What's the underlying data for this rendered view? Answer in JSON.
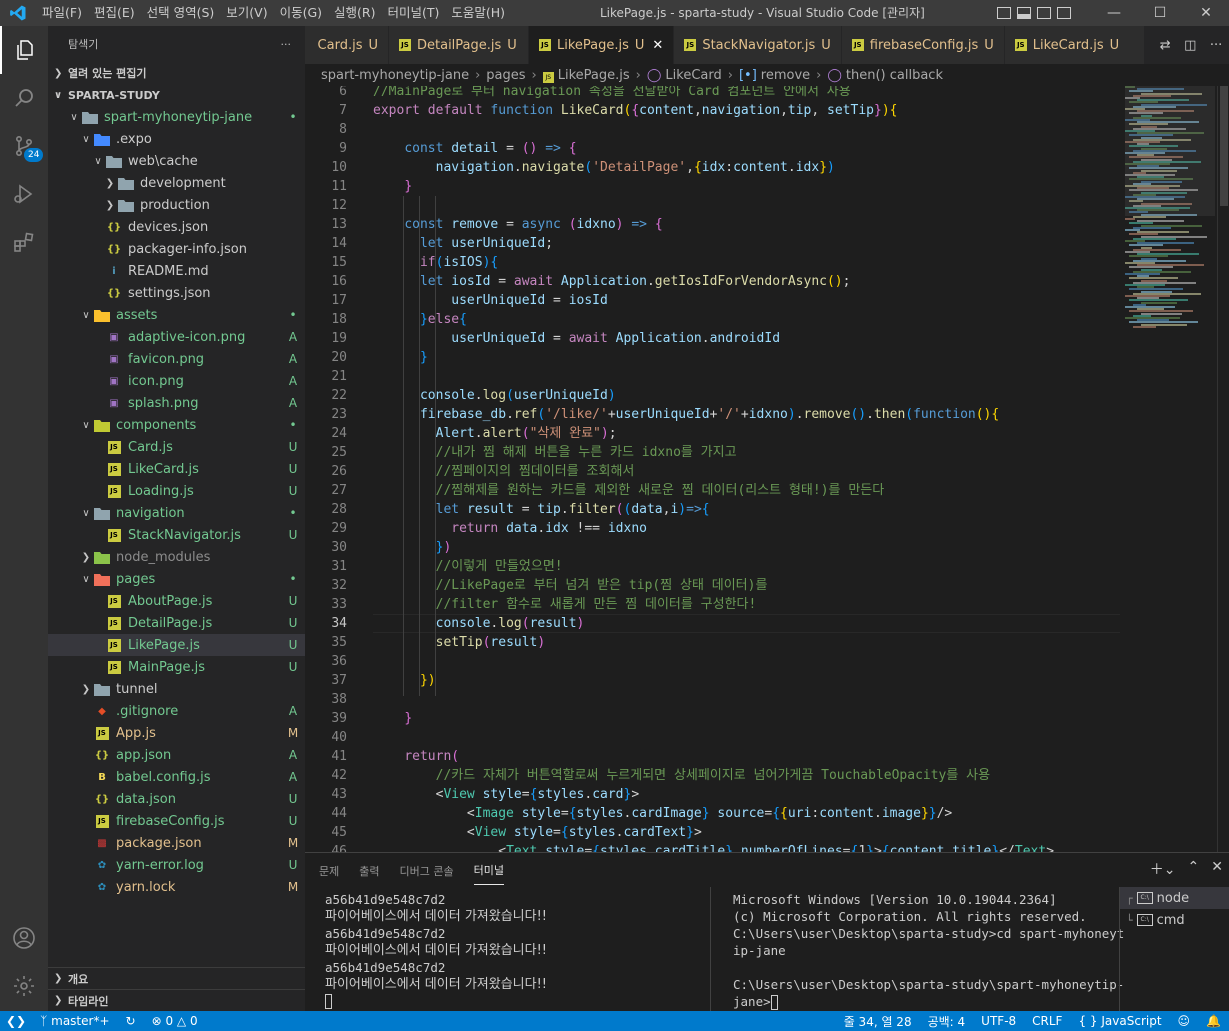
{
  "titlebar": {
    "menu": [
      "파일(F)",
      "편집(E)",
      "선택 영역(S)",
      "보기(V)",
      "이동(G)",
      "실행(R)",
      "터미널(T)",
      "도움말(H)"
    ],
    "title": "LikePage.js - sparta-study - Visual Studio Code [관리자]"
  },
  "activity": {
    "badge": "24"
  },
  "sidebar": {
    "header": "탐색기",
    "open_editors": "열려 있는 편집기",
    "root": "SPARTA-STUDY",
    "tree": [
      {
        "label": "spart-myhoneytip-jane",
        "depth": 1,
        "kind": "folder-open",
        "status": "•",
        "color": "#73c991"
      },
      {
        "label": ".expo",
        "depth": 2,
        "kind": "folder-open",
        "status": "",
        "color": "#cccccc"
      },
      {
        "label": "web\\cache",
        "depth": 3,
        "kind": "folder-open",
        "status": "",
        "color": "#cccccc"
      },
      {
        "label": "development",
        "depth": 4,
        "kind": "folder",
        "status": "",
        "color": "#cccccc"
      },
      {
        "label": "production",
        "depth": 4,
        "kind": "folder",
        "status": "",
        "color": "#cccccc"
      },
      {
        "label": "devices.json",
        "depth": 3,
        "kind": "json",
        "status": "",
        "color": "#cccccc"
      },
      {
        "label": "packager-info.json",
        "depth": 3,
        "kind": "json",
        "status": "",
        "color": "#cccccc"
      },
      {
        "label": "README.md",
        "depth": 3,
        "kind": "info",
        "status": "",
        "color": "#cccccc"
      },
      {
        "label": "settings.json",
        "depth": 3,
        "kind": "json",
        "status": "",
        "color": "#cccccc"
      },
      {
        "label": "assets",
        "depth": 2,
        "kind": "folder-open",
        "status": "•",
        "color": "#73c991"
      },
      {
        "label": "adaptive-icon.png",
        "depth": 3,
        "kind": "img",
        "status": "A",
        "color": "#73c991"
      },
      {
        "label": "favicon.png",
        "depth": 3,
        "kind": "img",
        "status": "A",
        "color": "#73c991"
      },
      {
        "label": "icon.png",
        "depth": 3,
        "kind": "img",
        "status": "A",
        "color": "#73c991"
      },
      {
        "label": "splash.png",
        "depth": 3,
        "kind": "img",
        "status": "A",
        "color": "#73c991"
      },
      {
        "label": "components",
        "depth": 2,
        "kind": "folder-open",
        "status": "•",
        "color": "#73c991"
      },
      {
        "label": "Card.js",
        "depth": 3,
        "kind": "js",
        "status": "U",
        "color": "#73c991"
      },
      {
        "label": "LikeCard.js",
        "depth": 3,
        "kind": "js",
        "status": "U",
        "color": "#73c991"
      },
      {
        "label": "Loading.js",
        "depth": 3,
        "kind": "js",
        "status": "U",
        "color": "#73c991"
      },
      {
        "label": "navigation",
        "depth": 2,
        "kind": "folder-open",
        "status": "•",
        "color": "#73c991"
      },
      {
        "label": "StackNavigator.js",
        "depth": 3,
        "kind": "js",
        "status": "U",
        "color": "#73c991"
      },
      {
        "label": "node_modules",
        "depth": 2,
        "kind": "folder",
        "status": "",
        "color": "#8c8c8c"
      },
      {
        "label": "pages",
        "depth": 2,
        "kind": "folder-open",
        "status": "•",
        "color": "#73c991"
      },
      {
        "label": "AboutPage.js",
        "depth": 3,
        "kind": "js",
        "status": "U",
        "color": "#73c991"
      },
      {
        "label": "DetailPage.js",
        "depth": 3,
        "kind": "js",
        "status": "U",
        "color": "#73c991"
      },
      {
        "label": "LikePage.js",
        "depth": 3,
        "kind": "js",
        "status": "U",
        "color": "#73c991",
        "selected": true
      },
      {
        "label": "MainPage.js",
        "depth": 3,
        "kind": "js",
        "status": "U",
        "color": "#73c991"
      },
      {
        "label": "tunnel",
        "depth": 2,
        "kind": "folder",
        "status": "",
        "color": "#cccccc"
      },
      {
        "label": ".gitignore",
        "depth": 2,
        "kind": "git",
        "status": "A",
        "color": "#73c991"
      },
      {
        "label": "App.js",
        "depth": 2,
        "kind": "js",
        "status": "M",
        "color": "#e2c08d"
      },
      {
        "label": "app.json",
        "depth": 2,
        "kind": "json",
        "status": "A",
        "color": "#73c991"
      },
      {
        "label": "babel.config.js",
        "depth": 2,
        "kind": "babel",
        "status": "A",
        "color": "#73c991"
      },
      {
        "label": "data.json",
        "depth": 2,
        "kind": "json",
        "status": "U",
        "color": "#73c991"
      },
      {
        "label": "firebaseConfig.js",
        "depth": 2,
        "kind": "js",
        "status": "U",
        "color": "#73c991"
      },
      {
        "label": "package.json",
        "depth": 2,
        "kind": "npm",
        "status": "M",
        "color": "#e2c08d"
      },
      {
        "label": "yarn-error.log",
        "depth": 2,
        "kind": "yarn",
        "status": "U",
        "color": "#73c991"
      },
      {
        "label": "yarn.lock",
        "depth": 2,
        "kind": "yarn",
        "status": "M",
        "color": "#e2c08d"
      }
    ],
    "outline": "개요",
    "timeline": "타임라인"
  },
  "tabs": [
    {
      "label": "Card.js",
      "status": "U",
      "active": false
    },
    {
      "label": "DetailPage.js",
      "status": "U",
      "active": false
    },
    {
      "label": "LikePage.js",
      "status": "U",
      "active": true
    },
    {
      "label": "StackNavigator.js",
      "status": "U",
      "active": false
    },
    {
      "label": "firebaseConfig.js",
      "status": "U",
      "active": false
    },
    {
      "label": "LikeCard.js",
      "status": "U",
      "active": false
    }
  ],
  "breadcrumb": [
    "spart-myhoneytip-jane",
    "pages",
    "LikePage.js",
    "LikeCard",
    "remove",
    "then() callback"
  ],
  "code": {
    "current_line": 34,
    "lines": [
      {
        "n": 6,
        "src": "[[c|//MainPage로 부터 navigation 속성을 전달받아 Card 컴포넌트 안에서 사용]]"
      },
      {
        "n": 7,
        "src": "[[kc|export]] [[kc|default]] [[k|function]] [[f|LikeCard]][[b1|(]][[b2|{]][[v|content]],[[v|navigation]],[[v|tip]], [[v|setTip]][[b2|}]][[b1|)]][[b1|{]]"
      },
      {
        "n": 8,
        "src": ""
      },
      {
        "n": 9,
        "src": "    [[k|const]] [[v|detail]] = [[b2|()]] [[k|=>]] [[b2|{]]"
      },
      {
        "n": 10,
        "src": "        [[v|navigation]].[[f|navigate]][[b3|(]][[s|'DetailPage']],[[b1|{]][[v|idx]]:[[v|content]].[[v|idx]][[b1|}]][[b3|)]]"
      },
      {
        "n": 11,
        "src": "    [[b2|}]]"
      },
      {
        "n": 12,
        "src": ""
      },
      {
        "n": 13,
        "src": "    [[k|const]] [[v|remove]] = [[k|async]] [[b2|(]][[v|idxno]][[b2|)]] [[k|=>]] [[b2|{]]"
      },
      {
        "n": 14,
        "src": "      [[k|let]] [[v|userUniqueId]];"
      },
      {
        "n": 15,
        "src": "      [[kc|if]][[b3|(]][[v|isIOS]][[b3|)]][[b3|{]]"
      },
      {
        "n": 16,
        "src": "      [[k|let]] [[v|iosId]] = [[kc|await]] [[v|Application]].[[f|getIosIdForVendorAsync]][[b1|()]];"
      },
      {
        "n": 17,
        "src": "          [[v|userUniqueId]] = [[v|iosId]]"
      },
      {
        "n": 18,
        "src": "      [[b3|}]][[kc|else]][[b3|{]]"
      },
      {
        "n": 19,
        "src": "          [[v|userUniqueId]] = [[kc|await]] [[v|Application]].[[v|androidId]]"
      },
      {
        "n": 20,
        "src": "      [[b3|}]]"
      },
      {
        "n": 21,
        "src": ""
      },
      {
        "n": 22,
        "src": "      [[v|console]].[[f|log]][[b3|(]][[v|userUniqueId]][[b3|)]]"
      },
      {
        "n": 23,
        "src": "      [[v|firebase_db]].[[f|ref]][[b3|(]][[s|'/like/']]+[[v|userUniqueId]]+[[s|'/']]+[[v|idxno]][[b3|)]].[[f|remove]][[b3|()]].[[f|then]][[b3|(]][[k|function]][[b1|()]][[b1|{]]"
      },
      {
        "n": 24,
        "src": "        [[v|Alert]].[[f|alert]][[b2|(]][[s|\"삭제 완료\"]][[b2|)]];"
      },
      {
        "n": 25,
        "src": "        [[c|//내가 찜 해제 버튼을 누른 카드 idxno를 가지고]]"
      },
      {
        "n": 26,
        "src": "        [[c|//찜페이지의 찜데이터를 조회해서]]"
      },
      {
        "n": 27,
        "src": "        [[c|//찜해제를 원하는 카드를 제외한 새로운 찜 데이터(리스트 형태!)를 만든다]]"
      },
      {
        "n": 28,
        "src": "        [[k|let]] [[v|result]] = [[v|tip]].[[f|filter]][[b2|(]][[b3|(]][[v|data]],[[v|i]][[b3|)]][[k|=>]][[b3|{]]"
      },
      {
        "n": 29,
        "src": "          [[kc|return]] [[v|data]].[[v|idx]] !== [[v|idxno]]"
      },
      {
        "n": 30,
        "src": "        [[b3|}]][[b2|)]]"
      },
      {
        "n": 31,
        "src": "        [[c|//이렇게 만들었으면!]]"
      },
      {
        "n": 32,
        "src": "        [[c|//LikePage로 부터 넘겨 받은 tip(찜 상태 데이터)를]]"
      },
      {
        "n": 33,
        "src": "        [[c|//filter 함수로 새롭게 만든 찜 데이터를 구성한다!]]"
      },
      {
        "n": 34,
        "src": "        [[v|console]].[[f|log]][[b2|(]][[v|result]][[b2|)]]"
      },
      {
        "n": 35,
        "src": "        [[f|setTip]][[b2|(]][[v|result]][[b2|)]]"
      },
      {
        "n": 36,
        "src": ""
      },
      {
        "n": 37,
        "src": "      [[b1|})]]"
      },
      {
        "n": 38,
        "src": ""
      },
      {
        "n": 39,
        "src": "    [[b2|}]]"
      },
      {
        "n": 40,
        "src": ""
      },
      {
        "n": 41,
        "src": "    [[kc|return]][[b2|(]]"
      },
      {
        "n": 42,
        "src": "        [[c|//카드 자체가 버튼역할로써 누르게되면 상세페이지로 넘어가게끔 TouchableOpacity를 사용]]"
      },
      {
        "n": 43,
        "src": "        [[p|<]][[tg|View]] [[at|style]]=[[b3|{]][[v|styles]].[[v|card]][[b3|}]][[p|>]]"
      },
      {
        "n": 44,
        "src": "            [[p|<]][[tg|Image]] [[at|style]]=[[b3|{]][[v|styles]].[[v|cardImage]][[b3|}]] [[at|source]]=[[b3|{]][[b1|{]][[v|uri]]:[[v|content]].[[v|image]][[b1|}]][[b3|}]][[p|/>]]"
      },
      {
        "n": 45,
        "src": "            [[p|<]][[tg|View]] [[at|style]]=[[b3|{]][[v|styles]].[[v|cardText]][[b3|}]][[p|>]]"
      },
      {
        "n": 46,
        "src": "                [[p|<]][[tg|Text]] [[at|style]]=[[b3|{]][[v|styles]].[[v|cardTitle]][[b3|}]] [[at|numberOfLines]]=[[b3|{]]1[[b3|}]][[p|>]][[b3|{]][[v|content]].[[v|title]][[b3|}]][[p|</]][[tg|Text]][[p|>]]"
      }
    ]
  },
  "panel": {
    "tabs": [
      "문제",
      "출력",
      "디버그 콘솔",
      "터미널"
    ],
    "active_tab": "터미널",
    "term_left": [
      "a56b41d9e548c7d2",
      "파이어베이스에서 데이터 가져왔습니다!!",
      "a56b41d9e548c7d2",
      "파이어베이스에서 데이터 가져왔습니다!!",
      "a56b41d9e548c7d2",
      "파이어베이스에서 데이터 가져왔습니다!!"
    ],
    "term_right": [
      "Microsoft Windows [Version 10.0.19044.2364]",
      "(c) Microsoft Corporation. All rights reserved.",
      "C:\\Users\\user\\Desktop\\sparta-study>cd spart-myhoneyt",
      "ip-jane",
      "",
      "C:\\Users\\user\\Desktop\\sparta-study\\spart-myhoneytip-",
      "jane>"
    ],
    "terminals": [
      "node",
      "cmd"
    ]
  },
  "statusbar": {
    "branch": "master*+",
    "errors": "0",
    "warnings": "0",
    "position": "줄 34, 열 28",
    "spaces": "공백: 4",
    "encoding": "UTF-8",
    "eol": "CRLF",
    "language": "JavaScript"
  },
  "colors": {
    "accent": "#007acc",
    "git_added": "#73c991",
    "git_modified": "#e2c08d"
  }
}
